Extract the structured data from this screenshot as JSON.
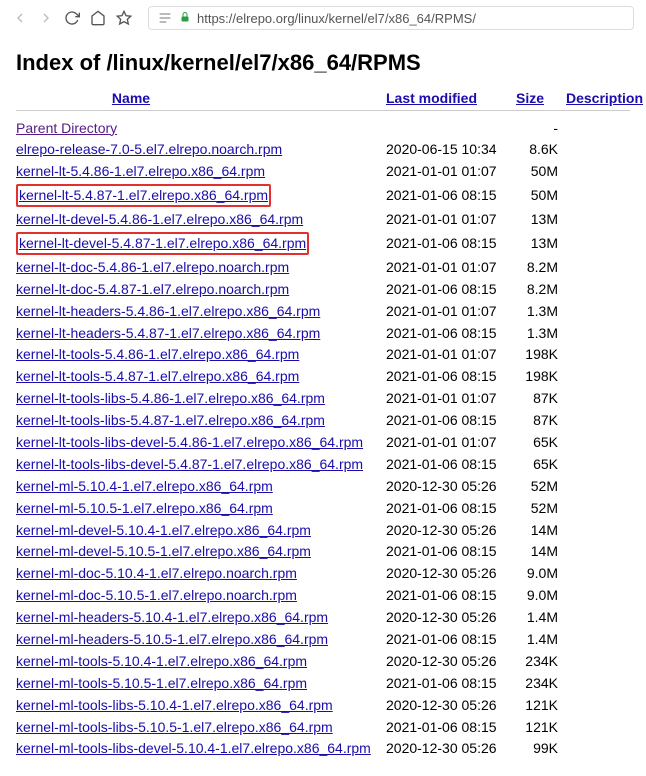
{
  "toolbar": {
    "url": "https://elrepo.org/linux/kernel/el7/x86_64/RPMS/"
  },
  "page": {
    "title": "Index of /linux/kernel/el7/x86_64/RPMS"
  },
  "headers": {
    "name": "Name",
    "modified": "Last modified",
    "size": "Size",
    "description": "Description"
  },
  "parent": {
    "label": "Parent Directory",
    "size": "-"
  },
  "rows": [
    {
      "name": "elrepo-release-7.0-5.el7.elrepo.noarch.rpm",
      "modified": "2020-06-15 10:34",
      "size": "8.6K",
      "highlight": false
    },
    {
      "name": "kernel-lt-5.4.86-1.el7.elrepo.x86_64.rpm",
      "modified": "2021-01-01 01:07",
      "size": "50M",
      "highlight": false
    },
    {
      "name": "kernel-lt-5.4.87-1.el7.elrepo.x86_64.rpm",
      "modified": "2021-01-06 08:15",
      "size": "50M",
      "highlight": true
    },
    {
      "name": "kernel-lt-devel-5.4.86-1.el7.elrepo.x86_64.rpm",
      "modified": "2021-01-01 01:07",
      "size": "13M",
      "highlight": false
    },
    {
      "name": "kernel-lt-devel-5.4.87-1.el7.elrepo.x86_64.rpm",
      "modified": "2021-01-06 08:15",
      "size": "13M",
      "highlight": true
    },
    {
      "name": "kernel-lt-doc-5.4.86-1.el7.elrepo.noarch.rpm",
      "modified": "2021-01-01 01:07",
      "size": "8.2M",
      "highlight": false
    },
    {
      "name": "kernel-lt-doc-5.4.87-1.el7.elrepo.noarch.rpm",
      "modified": "2021-01-06 08:15",
      "size": "8.2M",
      "highlight": false
    },
    {
      "name": "kernel-lt-headers-5.4.86-1.el7.elrepo.x86_64.rpm",
      "modified": "2021-01-01 01:07",
      "size": "1.3M",
      "highlight": false
    },
    {
      "name": "kernel-lt-headers-5.4.87-1.el7.elrepo.x86_64.rpm",
      "modified": "2021-01-06 08:15",
      "size": "1.3M",
      "highlight": false
    },
    {
      "name": "kernel-lt-tools-5.4.86-1.el7.elrepo.x86_64.rpm",
      "modified": "2021-01-01 01:07",
      "size": "198K",
      "highlight": false
    },
    {
      "name": "kernel-lt-tools-5.4.87-1.el7.elrepo.x86_64.rpm",
      "modified": "2021-01-06 08:15",
      "size": "198K",
      "highlight": false
    },
    {
      "name": "kernel-lt-tools-libs-5.4.86-1.el7.elrepo.x86_64.rpm",
      "modified": "2021-01-01 01:07",
      "size": "87K",
      "highlight": false
    },
    {
      "name": "kernel-lt-tools-libs-5.4.87-1.el7.elrepo.x86_64.rpm",
      "modified": "2021-01-06 08:15",
      "size": "87K",
      "highlight": false
    },
    {
      "name": "kernel-lt-tools-libs-devel-5.4.86-1.el7.elrepo.x86_64.rpm",
      "modified": "2021-01-01 01:07",
      "size": "65K",
      "highlight": false
    },
    {
      "name": "kernel-lt-tools-libs-devel-5.4.87-1.el7.elrepo.x86_64.rpm",
      "modified": "2021-01-06 08:15",
      "size": "65K",
      "highlight": false
    },
    {
      "name": "kernel-ml-5.10.4-1.el7.elrepo.x86_64.rpm",
      "modified": "2020-12-30 05:26",
      "size": "52M",
      "highlight": false
    },
    {
      "name": "kernel-ml-5.10.5-1.el7.elrepo.x86_64.rpm",
      "modified": "2021-01-06 08:15",
      "size": "52M",
      "highlight": false
    },
    {
      "name": "kernel-ml-devel-5.10.4-1.el7.elrepo.x86_64.rpm",
      "modified": "2020-12-30 05:26",
      "size": "14M",
      "highlight": false
    },
    {
      "name": "kernel-ml-devel-5.10.5-1.el7.elrepo.x86_64.rpm",
      "modified": "2021-01-06 08:15",
      "size": "14M",
      "highlight": false
    },
    {
      "name": "kernel-ml-doc-5.10.4-1.el7.elrepo.noarch.rpm",
      "modified": "2020-12-30 05:26",
      "size": "9.0M",
      "highlight": false
    },
    {
      "name": "kernel-ml-doc-5.10.5-1.el7.elrepo.noarch.rpm",
      "modified": "2021-01-06 08:15",
      "size": "9.0M",
      "highlight": false
    },
    {
      "name": "kernel-ml-headers-5.10.4-1.el7.elrepo.x86_64.rpm",
      "modified": "2020-12-30 05:26",
      "size": "1.4M",
      "highlight": false
    },
    {
      "name": "kernel-ml-headers-5.10.5-1.el7.elrepo.x86_64.rpm",
      "modified": "2021-01-06 08:15",
      "size": "1.4M",
      "highlight": false
    },
    {
      "name": "kernel-ml-tools-5.10.4-1.el7.elrepo.x86_64.rpm",
      "modified": "2020-12-30 05:26",
      "size": "234K",
      "highlight": false
    },
    {
      "name": "kernel-ml-tools-5.10.5-1.el7.elrepo.x86_64.rpm",
      "modified": "2021-01-06 08:15",
      "size": "234K",
      "highlight": false
    },
    {
      "name": "kernel-ml-tools-libs-5.10.4-1.el7.elrepo.x86_64.rpm",
      "modified": "2020-12-30 05:26",
      "size": "121K",
      "highlight": false
    },
    {
      "name": "kernel-ml-tools-libs-5.10.5-1.el7.elrepo.x86_64.rpm",
      "modified": "2021-01-06 08:15",
      "size": "121K",
      "highlight": false
    },
    {
      "name": "kernel-ml-tools-libs-devel-5.10.4-1.el7.elrepo.x86_64.rpm",
      "modified": "2020-12-30 05:26",
      "size": "99K",
      "highlight": false
    }
  ]
}
